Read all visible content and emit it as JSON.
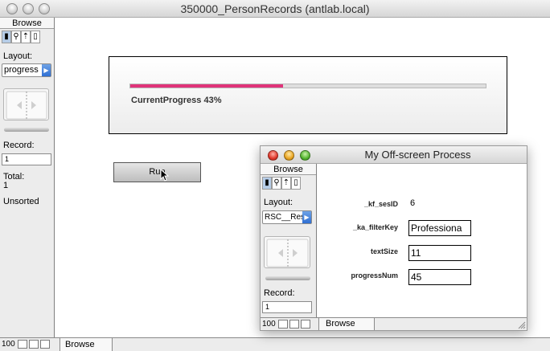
{
  "main_window": {
    "title": "350000_PersonRecords (antlab.local)",
    "sidebar": {
      "mode": "Browse",
      "layout_label": "Layout:",
      "layout_value": "progress",
      "record_label": "Record:",
      "record_value": "1",
      "total_label": "Total:",
      "total_value": "1",
      "sort_status": "Unsorted"
    },
    "bottom": {
      "zoom": "100",
      "mode": "Browse"
    },
    "progress": {
      "value": 43,
      "label": "CurrentProgress 43%",
      "fill_color": "#e0337a"
    },
    "run_button_label": "Run"
  },
  "sub_window": {
    "title": "My Off-screen Process",
    "sidebar": {
      "mode": "Browse",
      "layout_label": "Layout:",
      "layout_value": "RSC__Res",
      "record_label": "Record:",
      "record_value": "1"
    },
    "bottom": {
      "zoom": "100",
      "mode": "Browse"
    },
    "fields": [
      {
        "label": "_kf_sesID",
        "value": "6"
      },
      {
        "label": "_ka_filterKey",
        "value": "Professiona"
      },
      {
        "label": "textSize",
        "value": "11"
      },
      {
        "label": "progressNum",
        "value": "45"
      }
    ]
  }
}
